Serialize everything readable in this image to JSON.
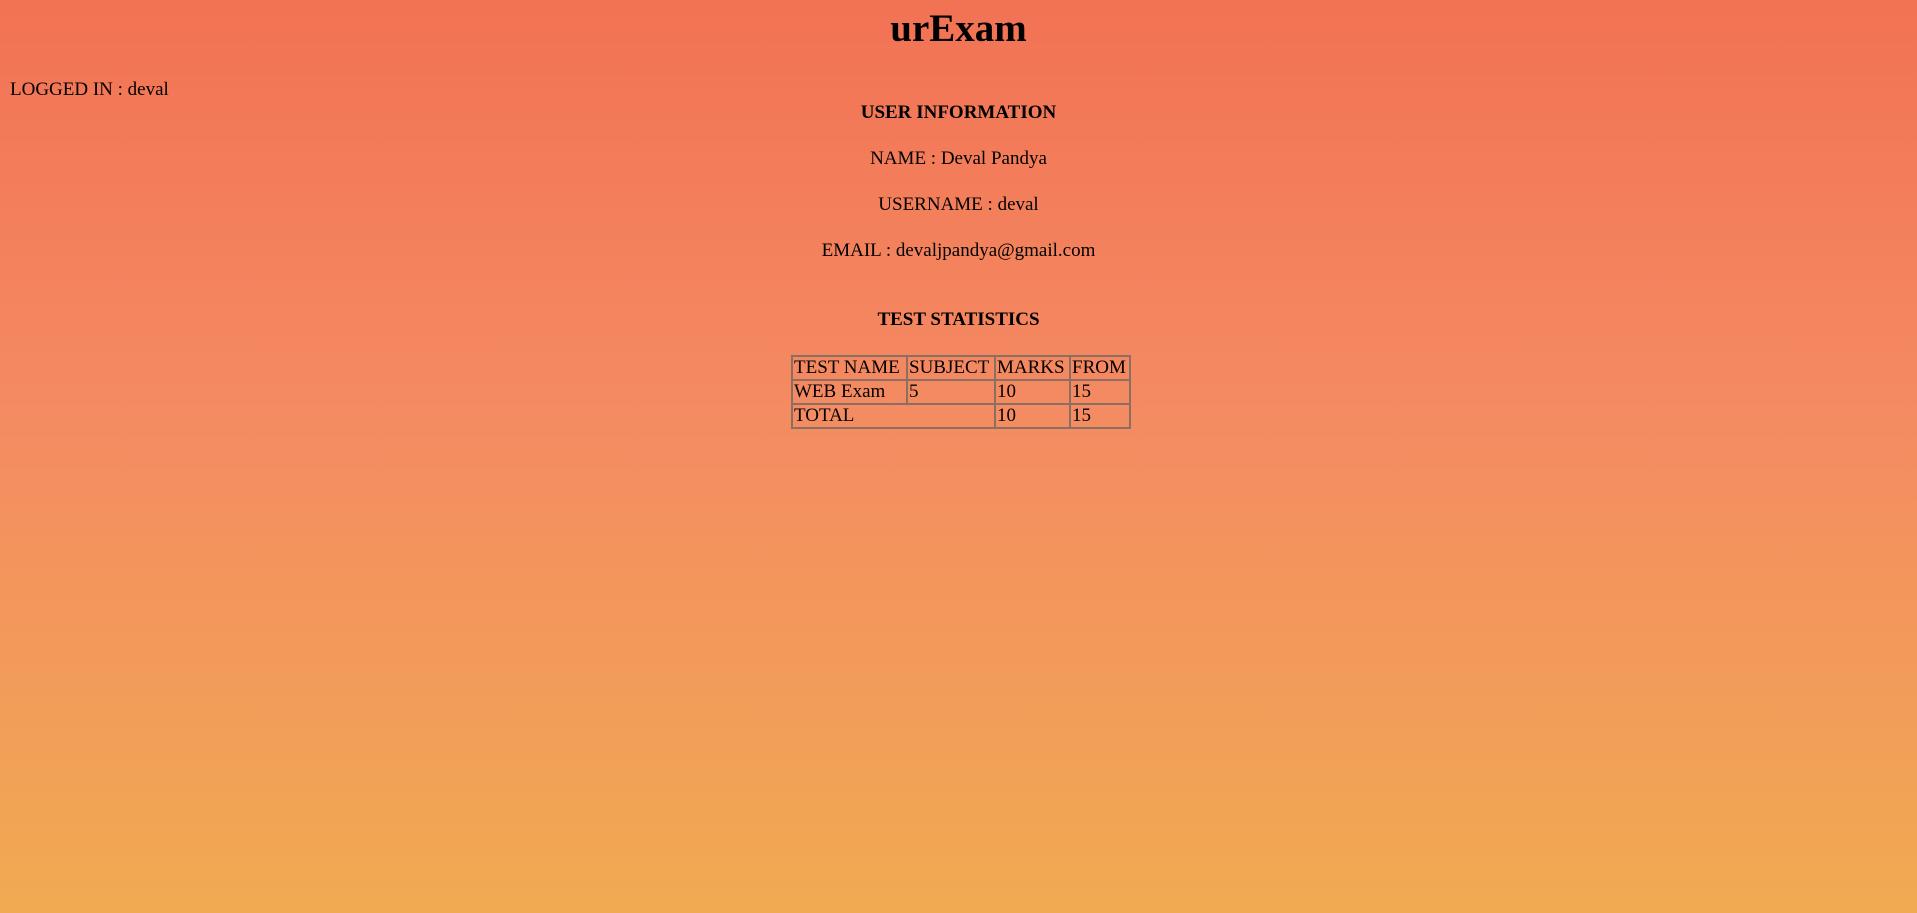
{
  "header": {
    "title": "urExam"
  },
  "session": {
    "logged_in_text": "LOGGED IN : deval"
  },
  "user_info": {
    "heading": "USER INFORMATION",
    "name_line": "NAME : Deval Pandya",
    "username_line": "USERNAME : deval",
    "email_line": "EMAIL : devaljpandya@gmail.com"
  },
  "test_stats": {
    "heading": "TEST STATISTICS",
    "columns": [
      "TEST NAME",
      "SUBJECT",
      "MARKS",
      "FROM"
    ],
    "rows": [
      {
        "test_name": "WEB Exam",
        "subject": "5",
        "marks": "10",
        "from": "15"
      }
    ],
    "total": {
      "label": "TOTAL",
      "marks": "10",
      "from": "15"
    }
  },
  "colors": {
    "gradient_top": "#f27254",
    "gradient_mid": "#f48b62",
    "gradient_bottom": "#f1aa52",
    "table_border": "#8a6f62"
  }
}
